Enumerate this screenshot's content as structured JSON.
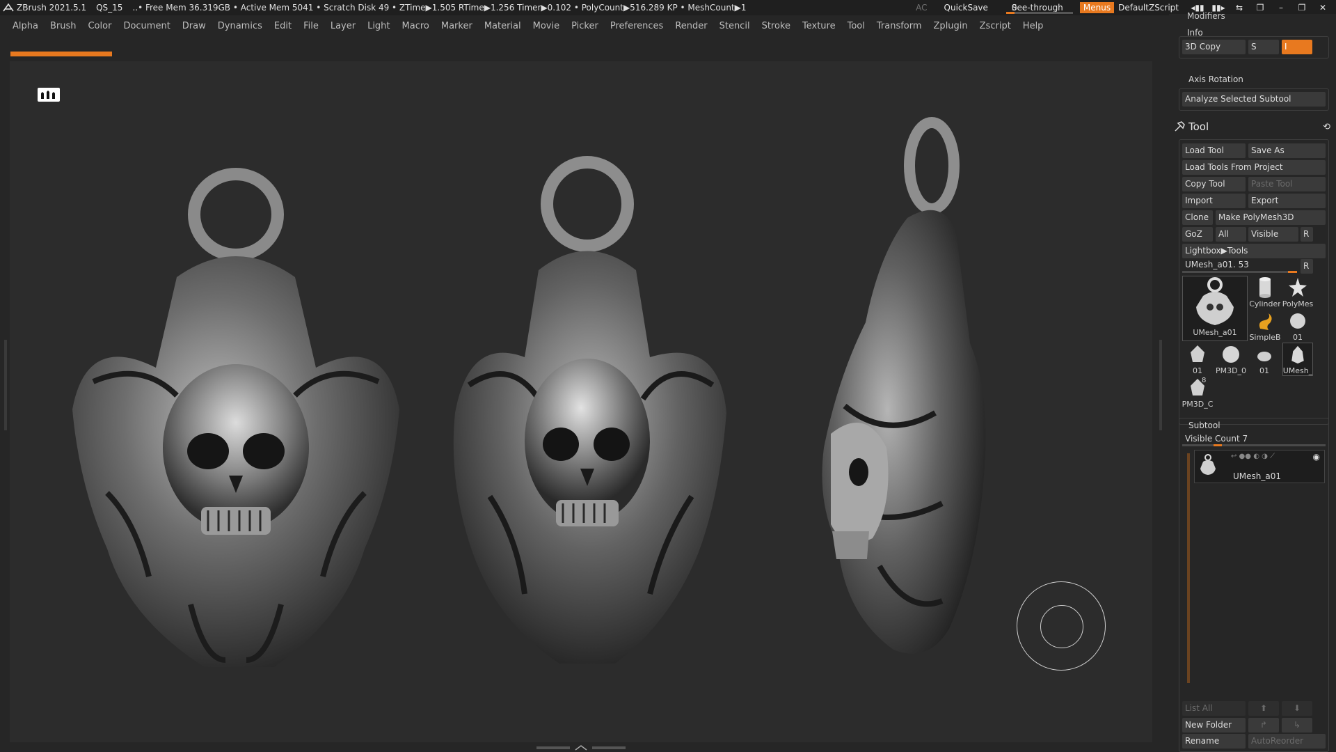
{
  "titlebar": {
    "app": "ZBrush 2021.5.1",
    "doc": "QS_15",
    "stats": "..• Free Mem 36.319GB • Active Mem 5041 • Scratch Disk 49 • ZTime▶1.505 RTime▶1.256 Timer▶0.102 • PolyCount▶516.289 KP • MeshCount▶1",
    "ac": "AC",
    "quicksave": "QuickSave",
    "seethrough_label": "See-through",
    "seethrough_value": "0",
    "seethrough_level": 0,
    "menus_label": "Menus",
    "script": "DefaultZScript"
  },
  "menubar": [
    "Alpha",
    "Brush",
    "Color",
    "Document",
    "Draw",
    "Dynamics",
    "Edit",
    "File",
    "Layer",
    "Light",
    "Macro",
    "Marker",
    "Material",
    "Movie",
    "Picker",
    "Preferences",
    "Render",
    "Stencil",
    "Stroke",
    "Texture",
    "Tool",
    "Transform",
    "Zplugin",
    "Zscript",
    "Help"
  ],
  "rpanel": {
    "modifiers": "Modifiers",
    "info": "Info",
    "copy3d": "3D Copy",
    "copy3d_s": "S",
    "copy3d_i": "I",
    "axis_rotation": "Axis Rotation",
    "analyze": "Analyze Selected Subtool",
    "tool_title": "Tool",
    "load_tool": "Load Tool",
    "save_as": "Save As",
    "load_project": "Load Tools From Project",
    "copy_tool": "Copy Tool",
    "paste_tool": "Paste Tool",
    "import": "Import",
    "export": "Export",
    "clone": "Clone",
    "make_polymesh": "Make PolyMesh3D",
    "goz": "GoZ",
    "all": "All",
    "visible": "Visible",
    "r": "R",
    "lightbox_tools": "Lightbox▶Tools",
    "current_tool": "UMesh_a01. 53",
    "current_tool_r": "R",
    "thumbs": {
      "main": "UMesh_a01",
      "cylinder": "Cylinder",
      "polymesh": "PolyMes",
      "simpleb": "SimpleB",
      "t01a": "01",
      "t01b": "01",
      "pm3d_0": "PM3D_0",
      "t01c": "01",
      "umesh": "UMesh_",
      "pm3d_c": "PM3D_C",
      "pm3d_c_count": "8"
    },
    "subtool": "Subtool",
    "visible_count": "Visible Count 7",
    "subtool_item": "UMesh_a01",
    "list_all": "List All",
    "new_folder": "New Folder",
    "rename": "Rename",
    "autoreorder": "AutoReorder"
  },
  "colors": {
    "accent": "#e8791f",
    "panel_bg": "#262626",
    "viewport_bg": "#2c2c2c",
    "button_bg": "#3a3a3a"
  }
}
